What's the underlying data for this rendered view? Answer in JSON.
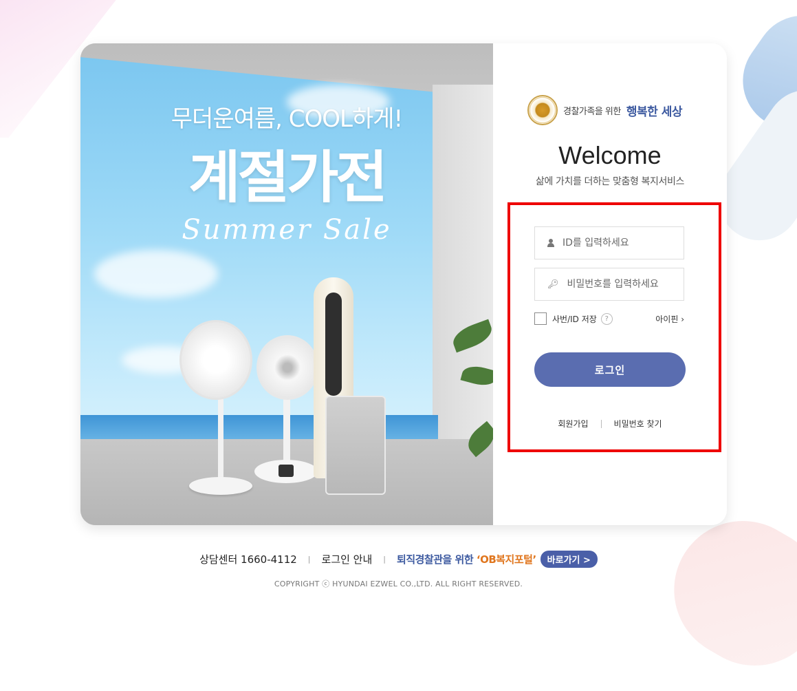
{
  "banner": {
    "subtitle": "무더운여름, COOL하게!",
    "title": "계절가전",
    "script": "Summer Sale"
  },
  "brand": {
    "small": "경찰가족을 위한",
    "big": "행복한 세상"
  },
  "welcome": {
    "title": "Welcome",
    "subtitle": "삶에 가치를 더하는 맞춤형 복지서비스"
  },
  "form": {
    "id_placeholder": "ID를 입력하세요",
    "pw_placeholder": "비밀번호를 입력하세요",
    "save_label": "사번/ID 저장",
    "help_mark": "?",
    "ipin_label": "아이핀 ›",
    "login_label": "로그인"
  },
  "links": {
    "signup": "회원가입",
    "find_pw": "비밀번호 찾기"
  },
  "footer": {
    "center": "상담센터 1660-4112",
    "login_guide": "로그인 안내",
    "ob_prefix": "퇴직경찰관을 위한 ",
    "ob_name": "‘OB복지포털’",
    "go_button": "바로가기 >",
    "divider": "|",
    "copyright": "COPYRIGHT ⓒ HYUNDAI EZWEL CO.,LTD. ALL RIGHT RESERVED."
  },
  "colors": {
    "accent": "#5a6db0",
    "brand_blue": "#3d5aa0",
    "highlight_orange": "#e0761e",
    "annotation_red": "#ee0000"
  }
}
